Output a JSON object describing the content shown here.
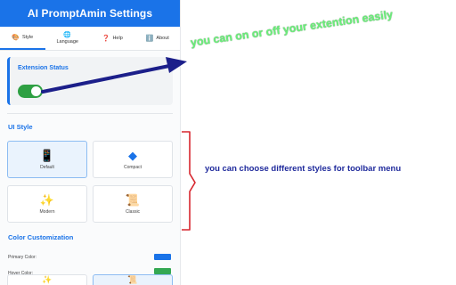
{
  "header": {
    "title": "AI PromptAmin Settings"
  },
  "tabs": [
    {
      "icon": "🎨",
      "label": "Style",
      "active": true
    },
    {
      "icon": "🌐",
      "label": "Language",
      "active": false
    },
    {
      "icon": "❓",
      "label": "Help",
      "active": false
    },
    {
      "icon": "ℹ️",
      "label": "About",
      "active": false
    }
  ],
  "extension_status": {
    "title": "Extension Status",
    "enabled": true
  },
  "ui_style": {
    "title": "UI Style",
    "options": [
      {
        "label": "Default",
        "icon": "📱",
        "icon_name": "phone-icon",
        "selected": true
      },
      {
        "label": "Compact",
        "icon": "◆",
        "icon_name": "diamond-icon",
        "selected": false
      },
      {
        "label": "Modern",
        "icon": "✨",
        "icon_name": "sparkles-icon",
        "selected": false
      },
      {
        "label": "Classic",
        "icon": "📜",
        "icon_name": "scroll-icon",
        "selected": false
      }
    ]
  },
  "color_customization": {
    "title": "Color Customization",
    "primary_label": "Primary Color:",
    "primary_color": "#1a73e8",
    "secondary_label": "Hover Color:",
    "secondary_color": "#34a853"
  },
  "annotations": {
    "toggle_note": "you can on or off your extention easily",
    "style_note": "you can choose different styles for toolbar menu"
  },
  "colors": {
    "accent": "#1a73e8",
    "toggle_on": "#2ea043",
    "note_green": "#6af07a",
    "note_blue": "#1f2a9c",
    "arrow": "#1c1f8a",
    "bracket": "#d7262e"
  }
}
